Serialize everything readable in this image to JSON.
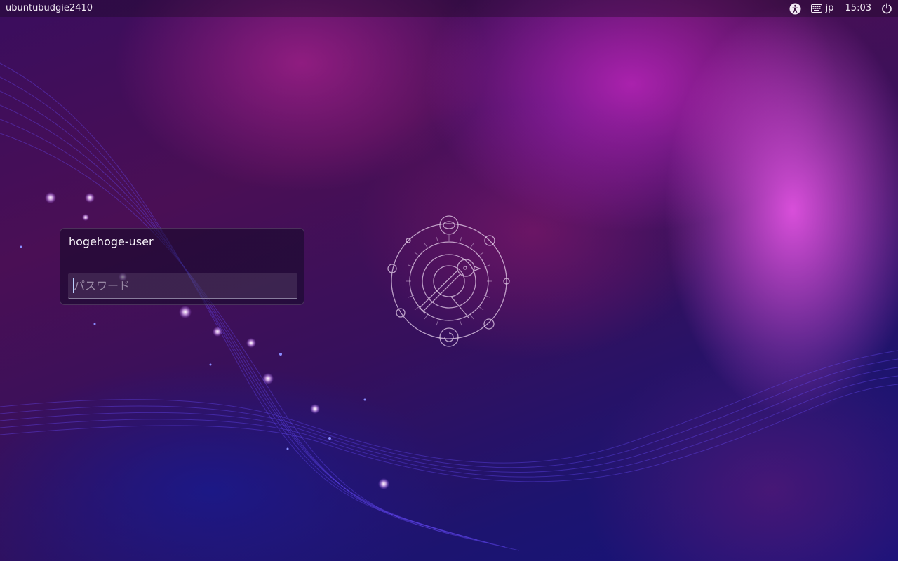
{
  "top_bar": {
    "hostname": "ubuntubudgie2410",
    "accessibility_icon": "accessibility-icon",
    "keyboard_icon": "keyboard-icon",
    "keyboard_layout": "jp",
    "clock": "15:03",
    "power_icon": "power-icon"
  },
  "login": {
    "username": "hogehoge-user",
    "password_placeholder": "パスワード",
    "password_value": ""
  },
  "logo": {
    "icon": "ubuntu-budgie-logo-icon"
  },
  "colors": {
    "panel_text": "#f2eaf4",
    "accent_pink": "#f55af0",
    "background_deep": "#15127a"
  }
}
